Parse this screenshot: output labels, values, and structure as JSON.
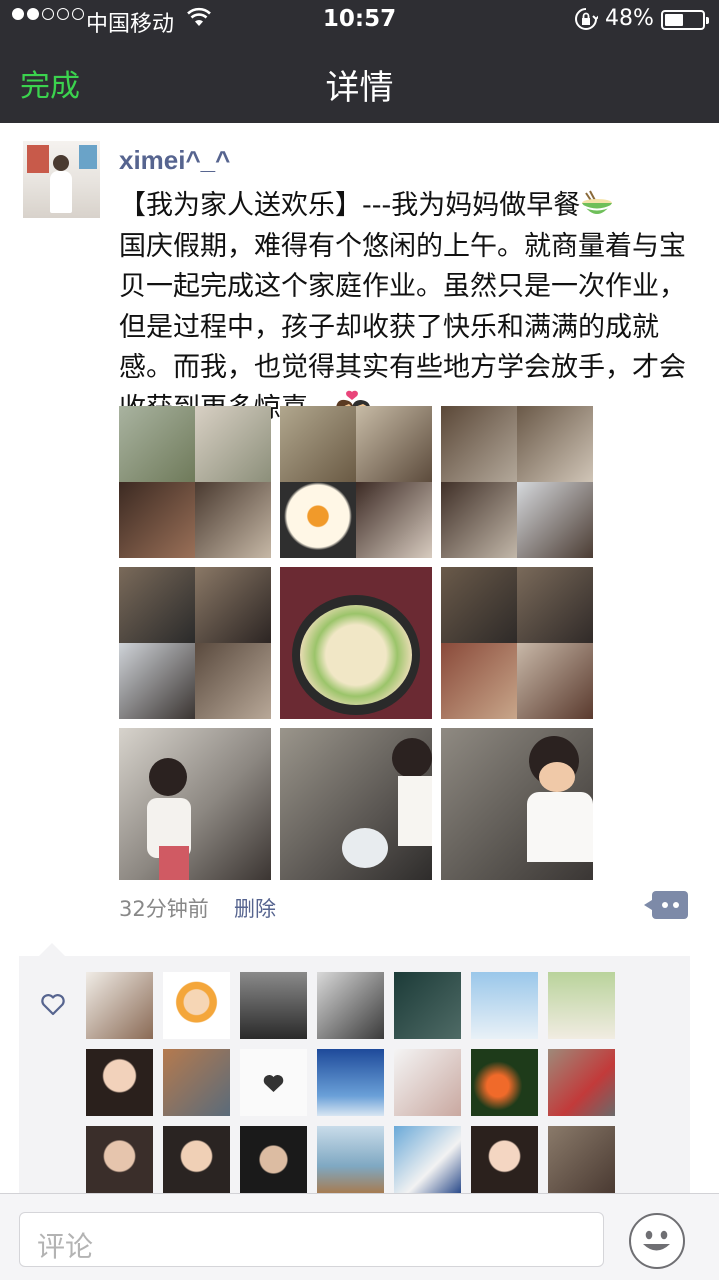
{
  "status_bar": {
    "signal_dots": [
      "full",
      "full",
      "empty",
      "empty",
      "empty"
    ],
    "carrier": "中国移动",
    "time": "10:57",
    "battery_percent": "48%",
    "battery_level": 0.48
  },
  "nav": {
    "done_label": "完成",
    "title": "详情",
    "done_color": "#3bd34e"
  },
  "post": {
    "username": "ximei^_^",
    "text_line1": "【我为家人送欢乐】---我为妈妈做早餐",
    "text_body": "国庆假期，难得有个悠闲的上午。就商量着与宝贝一起完成这个家庭作业。虽然只是一次作业，但是过程中，孩子却收获了快乐和满满的成就感。而我，也觉得其实有些地方学会放手，才会收获到更多惊喜。",
    "emoji_1": "noodle-bowl-icon",
    "emoji_2": "couple-kiss-icon",
    "photos_count": 9,
    "time": "32分钟前",
    "delete_label": "删除",
    "comment_button_icon": "comment-bubble-icon"
  },
  "likes": {
    "icon": "heart-outline-icon",
    "avatars": [
      "liker-avatar",
      "liker-avatar",
      "liker-avatar",
      "liker-avatar",
      "liker-avatar",
      "liker-avatar",
      "liker-avatar",
      "liker-avatar",
      "liker-avatar",
      "liker-avatar",
      "liker-avatar",
      "liker-avatar",
      "liker-avatar",
      "liker-avatar",
      "liker-avatar",
      "liker-avatar",
      "liker-avatar",
      "liker-avatar",
      "liker-avatar",
      "liker-avatar",
      "liker-avatar"
    ]
  },
  "comment_bar": {
    "placeholder": "评论",
    "emoji_button_icon": "smiley-icon"
  }
}
